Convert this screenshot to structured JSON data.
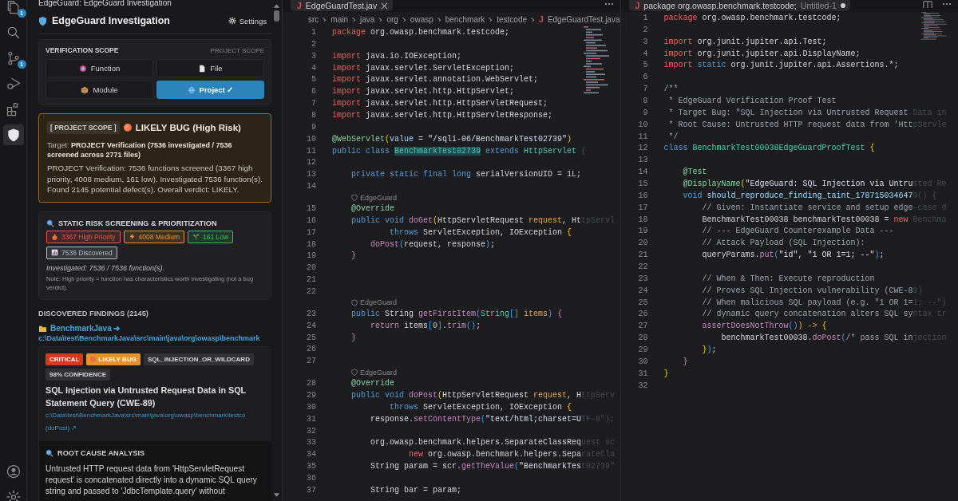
{
  "activity_bar": {
    "items": [
      {
        "kind": "files",
        "badge": "1",
        "selected": false
      },
      {
        "kind": "search",
        "selected": false
      },
      {
        "kind": "source",
        "badge": "1",
        "selected": false
      },
      {
        "kind": "run",
        "selected": false
      },
      {
        "kind": "extensions",
        "selected": false
      },
      {
        "kind": "shield",
        "selected": true
      }
    ],
    "bottom": [
      {
        "kind": "account"
      },
      {
        "kind": "manage"
      }
    ]
  },
  "sidebar": {
    "header": "EdgeGuard: EdgeGuard Investigation",
    "title": "EdgeGuard Investigation",
    "settings": "Settings",
    "scope": {
      "heading": "VERIFICATION SCOPE",
      "current": "PROJECT SCOPE",
      "options": [
        {
          "label": "Function",
          "kind": "function",
          "selected": false
        },
        {
          "label": "File",
          "kind": "file",
          "selected": false
        },
        {
          "label": "Module",
          "kind": "module",
          "selected": false
        },
        {
          "label": "Project ✓",
          "kind": "project",
          "selected": true
        }
      ]
    },
    "verdict": {
      "tag": "[ PROJECT SCOPE ]",
      "label": "LIKELY BUG (High Risk)",
      "target": "Target: **PROJECT Verification (7536 investigated / 7536 screened across 2771 files)**",
      "summary": "PROJECT Verification: 7536 functions screened (3367 high priority, 4008 medium, 161 low). Investigated 7536 function(s). Found 2145 potential defect(s). Overall verdict: LIKELY."
    },
    "screening": {
      "title": "STATIC RISK SCREENING & PRIORITIZATION",
      "chips": [
        {
          "label": "3367 High Priority",
          "kind": "fire",
          "color": "#f0564a"
        },
        {
          "label": "4008 Medium",
          "kind": "bolt",
          "color": "#e8962f"
        },
        {
          "label": "161 Low",
          "kind": "sprout",
          "color": "#3fbf5a"
        },
        {
          "label": "7536 Discovered",
          "kind": "chart",
          "color": "#b8bcc4"
        }
      ],
      "investigated": "Investigated: 7536 / 7536 function(s).",
      "note": "Note: High priority = function has characteristics worth investigating (not a bug verdict)."
    },
    "findings": {
      "heading": "DISCOVERED FINDINGS (2145)",
      "folder": "BenchmarkJava ➔",
      "path": "c:\\Data\\test\\BenchmarkJava\\src\\main\\java\\org\\owasp\\benchmark",
      "cards": [
        {
          "badges": [
            {
              "label": "CRITICAL",
              "kind": "critical"
            },
            {
              "label": "LIKELY BUG",
              "kind": "likely"
            },
            {
              "label": "SQL_INJECTION_OR_WILDCARD",
              "kind": "tag"
            },
            {
              "label": "98% CONFIDENCE",
              "kind": "tag"
            }
          ],
          "title": "SQL Injection via Untrusted Request Data in SQL Statement Query (CWE-89)",
          "location": "c:\\Data\\test\\BenchmarkJava\\src\\main\\java\\org\\owasp\\benchmark\\testco",
          "method": "(doPost) ↗",
          "analysis_heading": "ROOT CAUSE ANALYSIS",
          "analysis": "Untrusted HTTP request data from 'HttpServletRequest request' is concatenated directly into a dynamic SQL query string and passed to 'JdbcTemplate.query' without"
        }
      ]
    }
  },
  "editors": [
    {
      "tab": {
        "icon": "J",
        "label": "EdgeGuardTest.jav",
        "dirty": false
      },
      "breadcrumb": [
        "src",
        "main",
        "java",
        "org",
        "owasp",
        "benchmark",
        "testcode"
      ],
      "breadcrumb_file": {
        "icon": "J",
        "label": "EdgeGuardTest.java"
      },
      "lines": [
        {
          "kind": "code",
          "number": "1",
          "tokens": [
            {
              "kind": "kw",
              "text": "package"
            },
            {
              "kind": "plain",
              "text": " org.owasp.benchmark.testcode;"
            }
          ]
        },
        {
          "kind": "code",
          "number": "2"
        },
        {
          "kind": "code",
          "number": "3",
          "tokens": [
            {
              "kind": "kw",
              "text": "import"
            },
            {
              "kind": "plain",
              "text": " java.io.IOException;"
            }
          ]
        },
        {
          "kind": "code",
          "number": "4",
          "tokens": [
            {
              "kind": "kw",
              "text": "import"
            },
            {
              "kind": "plain",
              "text": " javax.servlet.ServletException;"
            }
          ]
        },
        {
          "kind": "code",
          "number": "5",
          "tokens": [
            {
              "kind": "kw",
              "text": "import"
            },
            {
              "kind": "plain",
              "text": " javax.servlet.annotation.WebServlet;"
            }
          ]
        },
        {
          "kind": "code",
          "number": "6",
          "tokens": [
            {
              "kind": "kw",
              "text": "import"
            },
            {
              "kind": "plain",
              "text": " javax.servlet.http.HttpServlet;"
            }
          ]
        },
        {
          "kind": "code",
          "number": "7",
          "tokens": [
            {
              "kind": "kw",
              "text": "import"
            },
            {
              "kind": "plain",
              "text": " javax.servlet.http.HttpServletRequest;"
            }
          ]
        },
        {
          "kind": "code",
          "number": "8",
          "tokens": [
            {
              "kind": "kw",
              "text": "import"
            },
            {
              "kind": "plain",
              "text": " javax.servlet.http.HttpServletResponse;"
            }
          ]
        },
        {
          "kind": "code",
          "number": "9"
        },
        {
          "kind": "code",
          "number": "10",
          "tokens": [
            {
              "kind": "ann",
              "text": "@WebServlet"
            },
            {
              "kind": "brace",
              "text": "("
            },
            {
              "kind": "var",
              "text": "value"
            },
            {
              "kind": "plain",
              "text": " = "
            },
            {
              "kind": "str",
              "text": "\"/sqli-06/BenchmarkTest02739\""
            },
            {
              "kind": "brace",
              "text": ")"
            }
          ]
        },
        {
          "kind": "code",
          "number": "11",
          "tokens": [
            {
              "kind": "decl",
              "text": "public class "
            },
            {
              "kind": "hl",
              "text": "BenchmarkTest02739"
            },
            {
              "kind": "decl",
              "text": " extends "
            },
            {
              "kind": "type",
              "text": "HttpServlet "
            },
            {
              "kind": "faded",
              "text": "{"
            }
          ]
        },
        {
          "kind": "code",
          "number": "12"
        },
        {
          "kind": "code",
          "number": "13",
          "tokens": [
            {
              "kind": "decl",
              "text": "    private static final long"
            },
            {
              "kind": "plain",
              "text": " serialVersionUID = 1L;"
            }
          ]
        },
        {
          "kind": "code",
          "number": "14"
        },
        {
          "kind": "lens",
          "text": "EdgeGuard"
        },
        {
          "kind": "code",
          "number": "15",
          "tokens": [
            {
              "kind": "ann",
              "text": "    @Override"
            }
          ]
        },
        {
          "kind": "code",
          "number": "16",
          "tokens": [
            {
              "kind": "decl",
              "text": "    public void "
            },
            {
              "kind": "fn",
              "text": "doGet"
            },
            {
              "kind": "brace",
              "text": "("
            },
            {
              "kind": "plain",
              "text": "HttpServletRequest "
            },
            {
              "kind": "param",
              "text": "request"
            },
            {
              "kind": "plain",
              "text": ", Ht"
            },
            {
              "kind": "faded",
              "text": "tpServl"
            }
          ]
        },
        {
          "kind": "code",
          "number": "17",
          "tokens": [
            {
              "kind": "decl",
              "text": "            throws"
            },
            {
              "kind": "plain",
              "text": " ServletException, IOException "
            },
            {
              "kind": "brace",
              "text": "{"
            }
          ]
        },
        {
          "kind": "code",
          "number": "18",
          "tokens": [
            {
              "kind": "fn",
              "text": "        doPost"
            },
            {
              "kind": "brace2",
              "text": "("
            },
            {
              "kind": "plain",
              "text": "request, response"
            },
            {
              "kind": "brace2",
              "text": ")"
            },
            {
              "kind": "plain",
              "text": ";"
            }
          ]
        },
        {
          "kind": "code",
          "number": "19",
          "tokens": [
            {
              "kind": "fn",
              "text": "    }"
            }
          ]
        },
        {
          "kind": "code",
          "number": "20"
        },
        {
          "kind": "code",
          "number": "21"
        },
        {
          "kind": "code",
          "number": "22"
        },
        {
          "kind": "lens",
          "text": "EdgeGuard"
        },
        {
          "kind": "code",
          "number": "23",
          "tokens": [
            {
              "kind": "decl",
              "text": "    public"
            },
            {
              "kind": "plain",
              "text": " String "
            },
            {
              "kind": "fn",
              "text": "getFirstItem"
            },
            {
              "kind": "brace2",
              "text": "("
            },
            {
              "kind": "type",
              "text": "String"
            },
            {
              "kind": "brace2",
              "text": "[] "
            },
            {
              "kind": "param",
              "text": "items"
            },
            {
              "kind": "brace2",
              "text": ") "
            },
            {
              "kind": "fn",
              "text": "{"
            }
          ]
        },
        {
          "kind": "code",
          "number": "24",
          "tokens": [
            {
              "kind": "flow",
              "text": "        return"
            },
            {
              "kind": "plain",
              "text": " items"
            },
            {
              "kind": "brace2",
              "text": "["
            },
            {
              "kind": "num",
              "text": "0"
            },
            {
              "kind": "brace2",
              "text": "]"
            },
            {
              "kind": "plain",
              "text": "."
            },
            {
              "kind": "fn",
              "text": "trim"
            },
            {
              "kind": "brace2",
              "text": "()"
            },
            {
              "kind": "plain",
              "text": ";"
            }
          ]
        },
        {
          "kind": "code",
          "number": "25",
          "tokens": [
            {
              "kind": "fn",
              "text": "    }"
            }
          ]
        },
        {
          "kind": "code",
          "number": "26"
        },
        {
          "kind": "code",
          "number": "27"
        },
        {
          "kind": "lens",
          "text": "EdgeGuard"
        },
        {
          "kind": "code",
          "number": "28",
          "tokens": [
            {
              "kind": "ann",
              "text": "    @Override"
            }
          ]
        },
        {
          "kind": "code",
          "number": "29",
          "tokens": [
            {
              "kind": "decl",
              "text": "    public void "
            },
            {
              "kind": "fn",
              "text": "doPost"
            },
            {
              "kind": "brace",
              "text": "("
            },
            {
              "kind": "plain",
              "text": "HttpServletRequest "
            },
            {
              "kind": "param",
              "text": "request"
            },
            {
              "kind": "plain",
              "text": ", H"
            },
            {
              "kind": "faded",
              "text": "ttpServ"
            }
          ]
        },
        {
          "kind": "code",
          "number": "30",
          "tokens": [
            {
              "kind": "decl",
              "text": "            throws"
            },
            {
              "kind": "plain",
              "text": " ServletException, IOException "
            },
            {
              "kind": "brace",
              "text": "{"
            }
          ]
        },
        {
          "kind": "code",
          "number": "31",
          "tokens": [
            {
              "kind": "plain",
              "text": "        response."
            },
            {
              "kind": "fn",
              "text": "setContentType"
            },
            {
              "kind": "brace2",
              "text": "("
            },
            {
              "kind": "str",
              "text": "\"text/html;charset=U"
            },
            {
              "kind": "faded",
              "text": "TF-8\");"
            }
          ]
        },
        {
          "kind": "code",
          "number": "32"
        },
        {
          "kind": "code",
          "number": "33",
          "tokens": [
            {
              "kind": "plain",
              "text": "        org.owasp.benchmark.helpers.SeparateClassReq"
            },
            {
              "kind": "faded",
              "text": "uest sc"
            }
          ]
        },
        {
          "kind": "code",
          "number": "34",
          "tokens": [
            {
              "kind": "kw",
              "text": "                new"
            },
            {
              "kind": "plain",
              "text": " org.owasp.benchmark.helpers.Sepa"
            },
            {
              "kind": "faded",
              "text": "rateCla"
            }
          ]
        },
        {
          "kind": "code",
          "number": "35",
          "tokens": [
            {
              "kind": "plain",
              "text": "        String param = scr."
            },
            {
              "kind": "fn",
              "text": "getTheValue"
            },
            {
              "kind": "brace2",
              "text": "("
            },
            {
              "kind": "str",
              "text": "\"BenchmarkTes"
            },
            {
              "kind": "faded",
              "text": "t02739\""
            }
          ]
        },
        {
          "kind": "code",
          "number": "36"
        },
        {
          "kind": "code",
          "number": "37",
          "tokens": [
            {
              "kind": "plain",
              "text": "        String bar = param;"
            }
          ]
        }
      ]
    },
    {
      "tab": {
        "icon": "J",
        "label": "package org.owasp.benchmark.testcode;",
        "detail": "Untitled-1",
        "dirty": true
      },
      "lines": [
        {
          "kind": "code",
          "number": "1",
          "tokens": [
            {
              "kind": "kw",
              "text": "package"
            },
            {
              "kind": "plain",
              "text": " org.owasp.benchmark.testcode;"
            }
          ]
        },
        {
          "kind": "code",
          "number": "2"
        },
        {
          "kind": "code",
          "number": "3",
          "tokens": [
            {
              "kind": "kw",
              "text": "import"
            },
            {
              "kind": "plain",
              "text": " org.junit.jupiter.api.Test;"
            }
          ]
        },
        {
          "kind": "code",
          "number": "4",
          "tokens": [
            {
              "kind": "kw",
              "text": "import"
            },
            {
              "kind": "plain",
              "text": " org.junit.jupiter.api.DisplayName;"
            }
          ]
        },
        {
          "kind": "code",
          "number": "5",
          "tokens": [
            {
              "kind": "kw",
              "text": "import "
            },
            {
              "kind": "decl",
              "text": "static"
            },
            {
              "kind": "plain",
              "text": " org.junit.jupiter.api.Assertions.*;"
            }
          ]
        },
        {
          "kind": "code",
          "number": "6"
        },
        {
          "kind": "code",
          "number": "7",
          "tokens": [
            {
              "kind": "com",
              "text": "/**"
            }
          ]
        },
        {
          "kind": "code",
          "number": "8",
          "tokens": [
            {
              "kind": "com",
              "text": " * EdgeGuard Verification Proof Test"
            }
          ]
        },
        {
          "kind": "code",
          "number": "9",
          "tokens": [
            {
              "kind": "com",
              "text": " * Target Bug: \"SQL Injection via Untrusted Request "
            },
            {
              "kind": "faded",
              "text": "Data in"
            }
          ]
        },
        {
          "kind": "code",
          "number": "10",
          "tokens": [
            {
              "kind": "com",
              "text": " * Root Cause: Untrusted HTTP request data from 'Htt"
            },
            {
              "kind": "faded",
              "text": "pServle"
            }
          ]
        },
        {
          "kind": "code",
          "number": "11",
          "tokens": [
            {
              "kind": "com",
              "text": " */"
            }
          ]
        },
        {
          "kind": "code",
          "number": "12",
          "tokens": [
            {
              "kind": "decl",
              "text": "class "
            },
            {
              "kind": "type",
              "text": "BenchmarkTest00038EdgeGuardProofTest "
            },
            {
              "kind": "brace",
              "text": "{"
            }
          ]
        },
        {
          "kind": "code",
          "number": "13"
        },
        {
          "kind": "code",
          "number": "14",
          "tokens": [
            {
              "kind": "ann",
              "text": "    @Test"
            }
          ]
        },
        {
          "kind": "code",
          "number": "15",
          "tokens": [
            {
              "kind": "ann",
              "text": "    @DisplayName"
            },
            {
              "kind": "brace",
              "text": "("
            },
            {
              "kind": "str",
              "text": "\"EdgeGuard: SQL Injection via Untru"
            },
            {
              "kind": "faded",
              "text": "sted Re"
            }
          ]
        },
        {
          "kind": "code",
          "number": "16",
          "tokens": [
            {
              "kind": "decl",
              "text": "    void "
            },
            {
              "kind": "var",
              "text": "should_reproduce_finding_taint_178715034647"
            },
            {
              "kind": "faded",
              "text": "9() {"
            }
          ]
        },
        {
          "kind": "code",
          "number": "17",
          "tokens": [
            {
              "kind": "com",
              "text": "        // Given: Instantiate service and setup edge"
            },
            {
              "kind": "faded",
              "text": "-case d"
            }
          ]
        },
        {
          "kind": "code",
          "number": "18",
          "tokens": [
            {
              "kind": "plain",
              "text": "        BenchmarkTest00038 benchmarkTest00038 = "
            },
            {
              "kind": "kw",
              "text": "new "
            },
            {
              "kind": "faded",
              "text": "Benchma"
            }
          ]
        },
        {
          "kind": "code",
          "number": "19",
          "tokens": [
            {
              "kind": "com",
              "text": "        // --- EdgeGuard Counterexample Data ---"
            }
          ]
        },
        {
          "kind": "code",
          "number": "20",
          "tokens": [
            {
              "kind": "com",
              "text": "        // Attack Payload (SQL Injection):"
            }
          ]
        },
        {
          "kind": "code",
          "number": "21",
          "tokens": [
            {
              "kind": "plain",
              "text": "        queryParams."
            },
            {
              "kind": "fn",
              "text": "put"
            },
            {
              "kind": "brace2",
              "text": "("
            },
            {
              "kind": "str",
              "text": "\"id\""
            },
            {
              "kind": "plain",
              "text": ", "
            },
            {
              "kind": "str",
              "text": "\"1 OR 1=1; --\""
            },
            {
              "kind": "brace2",
              "text": ")"
            },
            {
              "kind": "plain",
              "text": ";"
            }
          ]
        },
        {
          "kind": "code",
          "number": "22"
        },
        {
          "kind": "code",
          "number": "23",
          "tokens": [
            {
              "kind": "com",
              "text": "        // When & Then: Execute reproduction"
            }
          ]
        },
        {
          "kind": "code",
          "number": "24",
          "tokens": [
            {
              "kind": "com",
              "text": "        // Proves SQL Injection vulnerability (CWE-8"
            },
            {
              "kind": "faded",
              "text": "9)"
            }
          ]
        },
        {
          "kind": "code",
          "number": "25",
          "tokens": [
            {
              "kind": "com",
              "text": "        // When malicious SQL payload (e.g. \"1 OR 1="
            },
            {
              "kind": "faded",
              "text": "1; --\")"
            }
          ]
        },
        {
          "kind": "code",
          "number": "26",
          "tokens": [
            {
              "kind": "com",
              "text": "        // dynamic query concatenation alters SQL sy"
            },
            {
              "kind": "faded",
              "text": "ntax tr"
            }
          ]
        },
        {
          "kind": "code",
          "number": "27",
          "tokens": [
            {
              "kind": "fn",
              "text": "        assertDoesNotThrow"
            },
            {
              "kind": "brace2",
              "text": "()"
            },
            {
              "kind": "brace",
              "text": ") "
            },
            {
              "kind": "op",
              "text": "-> "
            },
            {
              "kind": "brace",
              "text": "{"
            }
          ]
        },
        {
          "kind": "code",
          "number": "28",
          "tokens": [
            {
              "kind": "plain",
              "text": "            benchmarkTest00038."
            },
            {
              "kind": "fn",
              "text": "doPost"
            },
            {
              "kind": "brace2",
              "text": "("
            },
            {
              "kind": "com",
              "text": "/* pass SQL in"
            },
            {
              "kind": "faded",
              "text": "jection"
            }
          ]
        },
        {
          "kind": "code",
          "number": "29",
          "tokens": [
            {
              "kind": "brace",
              "text": "        }"
            },
            {
              "kind": "brace2",
              "text": ")"
            },
            {
              "kind": "plain",
              "text": ";"
            }
          ]
        },
        {
          "kind": "code",
          "number": "30",
          "tokens": [
            {
              "kind": "fn",
              "text": "    }"
            }
          ]
        },
        {
          "kind": "code",
          "number": "31",
          "tokens": [
            {
              "kind": "brace",
              "text": "}"
            }
          ]
        },
        {
          "kind": "code",
          "number": "32"
        }
      ]
    }
  ]
}
